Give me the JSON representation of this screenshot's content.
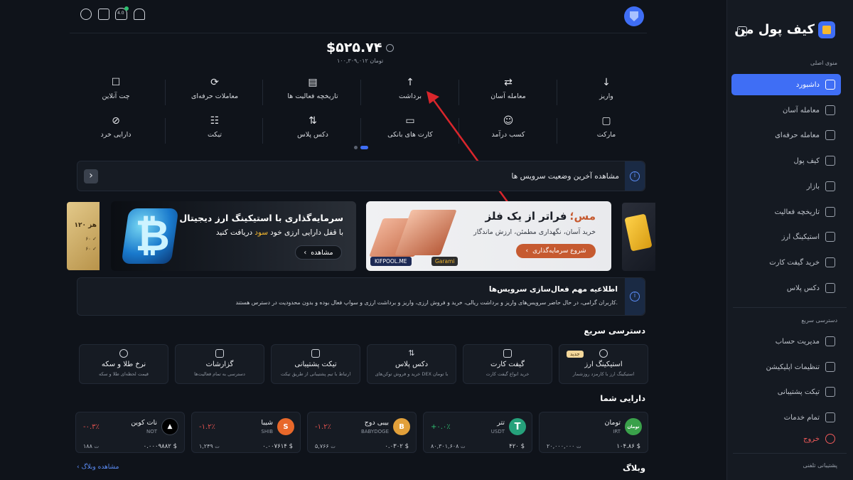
{
  "brand": {
    "name": "کیف پول من"
  },
  "sidebar": {
    "main_title": "منوی اصلی",
    "items": [
      {
        "label": "داشبورد",
        "active": true
      },
      {
        "label": "معامله آسان"
      },
      {
        "label": "معامله حرفه‌ای"
      },
      {
        "label": "کیف پول"
      },
      {
        "label": "بازار"
      },
      {
        "label": "تاریخچه فعالیت"
      },
      {
        "label": "استیکینگ ارز"
      },
      {
        "label": "خرید گیفت کارت"
      },
      {
        "label": "دکس پلاس"
      }
    ],
    "quick_title": "دسترسی سریع",
    "quick_items": [
      {
        "label": "مدیریت حساب"
      },
      {
        "label": "تنظیمات اپلیکیشن"
      },
      {
        "label": "تیکت پشتیبانی"
      },
      {
        "label": "تمام خدمات"
      },
      {
        "label": "خروج"
      }
    ],
    "support_title": "پشتیبانی تلفنی"
  },
  "topbar": {
    "badge": "4.0"
  },
  "balance": {
    "usd": "$۵۲۵.۷۴",
    "toman": "۱۰۰,۳۰۹,۰۱۲ تومان"
  },
  "actions": {
    "row1": [
      "واریز",
      "معامله آسان",
      "برداشت",
      "تاریخچه فعالیت ها",
      "معاملات حرفه‌ای",
      "چت آنلاین"
    ],
    "row2": [
      "مارکت",
      "کسب درآمد",
      "کارت های بانکی",
      "دکس پلاس",
      "تیکت",
      "دارایی خرد"
    ]
  },
  "status_notice": {
    "text": "مشاهده آخرین وضعیت سرویس ها"
  },
  "banners": {
    "stake_title": "سرمایه‌گذاری با استیکینگ ارز دیجیتال",
    "stake_sub_pre": "با قفل دارایی ارزی خود",
    "stake_sub_highlight": "سود",
    "stake_sub_post": "دریافت کنید",
    "stake_btn": "مشاهده",
    "copper_title_accent": "مس؛",
    "copper_title": "فراتر از یک فلز",
    "copper_sub": "خرید آسان، نگهداری مطمئن، ارزش ماندگار",
    "copper_btn": "شروع سرمایه‌گذاری",
    "copper_brand": "KIFPOOL.ME",
    "copper_brand2": "Garami",
    "left_partial_line1": "۱۲۰ هز",
    "left_partial_line2": "۶۰ ✓",
    "left_partial_line3": "۶۰ ✓"
  },
  "alert": {
    "title": "اطلاعیه مهم فعال‌سازی سرویس‌ها",
    "body": "کاربران گرامی، در حال حاضر سرویس‌های واریز و برداشت ریالی، خرید و فروش ارزی، واریز و برداشت ارزی و سواپ فعال بوده و بدون محدودیت در دسترس هستند."
  },
  "quick_access": {
    "title": "دسترسی سریع",
    "cards": [
      {
        "title": "استیکینگ ارز",
        "sub": "استیکینگ ارز با کارمزد روزشمار",
        "tag": "جدید"
      },
      {
        "title": "گیفت کارت",
        "sub": "خرید انواع گیفت کارت"
      },
      {
        "title": "دکس پلاس",
        "sub": "خرید و فروش توکن‌های DEX با تومان"
      },
      {
        "title": "تیکت پشتیبانی",
        "sub": "ارتباط با تیم پشتیبانی از طریق تیکت"
      },
      {
        "title": "گزارشات",
        "sub": "دسترسی به تمام فعالیت‌ها"
      },
      {
        "title": "نرخ طلا و سکه",
        "sub": "قیمت لحظه‌ای طلا و سکه"
      }
    ]
  },
  "assets": {
    "title": "دارایی شما",
    "items": [
      {
        "name": "تومان",
        "sym": "IRT",
        "logo": "تومان",
        "color": "#3aa14a",
        "balance": "۱۰۴.۸۶",
        "value": "۲۰,۰۰۰,۰۰۰",
        "cur": "ت",
        "change": ""
      },
      {
        "name": "تتر",
        "sym": "USDT",
        "logo": "T",
        "color": "#26a17b",
        "balance": "۴۲۰",
        "value": "۸۰,۳۰۱,۶۰۸",
        "cur": "ت",
        "change": "+۰.۰٪",
        "up": true
      },
      {
        "name": "بیبی دوج",
        "sym": "BABYDOGE",
        "logo": "B",
        "color": "#e2a03a",
        "balance": "۰.۰۳۰۲",
        "value": "۵,۷۶۶",
        "cur": "ت",
        "change": "-۱.۲٪"
      },
      {
        "name": "شیبا",
        "sym": "SHIB",
        "logo": "S",
        "color": "#e8682a",
        "balance": "۰.۰۰۷۶۱۴",
        "value": "۱,۲۴۹",
        "cur": "ت",
        "change": "-۱.۲٪"
      },
      {
        "name": "نات کوین",
        "sym": "NOT",
        "logo": "▲",
        "color": "#000000",
        "balance": "۰.۰۰۰۹۸۸۲",
        "value": "۱۸۸",
        "cur": "ت",
        "change": "-۰.۳٪"
      }
    ]
  },
  "blog": {
    "title": "وبلاگ",
    "link": "مشاهده وبلاگ"
  },
  "colors": {
    "accent": "#3f6ef5",
    "up": "#2fbf71",
    "down": "#e0524f"
  }
}
